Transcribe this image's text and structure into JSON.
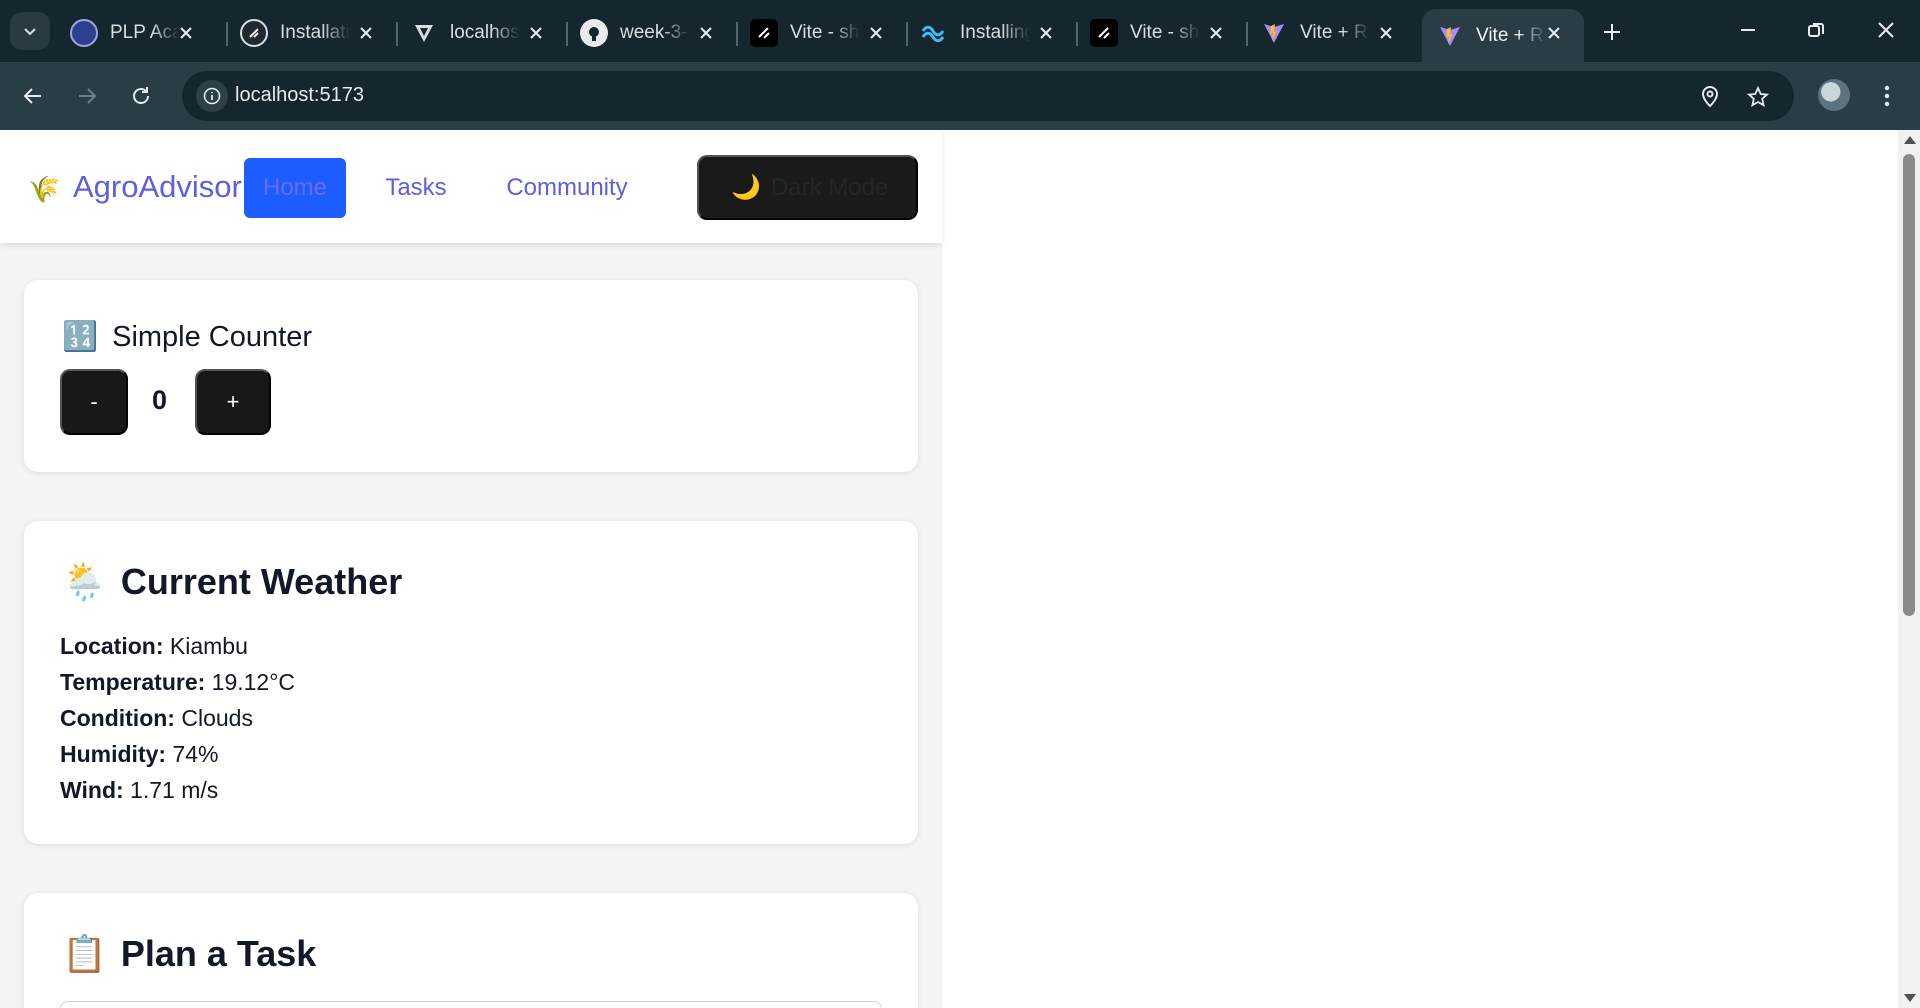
{
  "browser": {
    "tabs": [
      {
        "title": "PLP Academy",
        "favicon": "plp-icon"
      },
      {
        "title": "Installation",
        "favicon": "shadcn-icon"
      },
      {
        "title": "localhost",
        "favicon": "vercel-icon"
      },
      {
        "title": "week-3-",
        "favicon": "github-icon"
      },
      {
        "title": "Vite - shadcn",
        "favicon": "shadcn-icon"
      },
      {
        "title": "Installing",
        "favicon": "tailwind-icon"
      },
      {
        "title": "Vite - shadcn",
        "favicon": "shadcn-icon"
      },
      {
        "title": "Vite + React",
        "favicon": "vite-icon"
      },
      {
        "title": "Vite + React",
        "favicon": "vite-icon",
        "active": true
      }
    ],
    "url": "localhost:5173"
  },
  "app": {
    "brand": {
      "icon": "🌾",
      "name": "AgroAdvisor"
    },
    "nav": {
      "home": "Home",
      "tasks": "Tasks",
      "community": "Community"
    },
    "theme_toggle": {
      "icon": "🌙",
      "label": "Dark Mode"
    },
    "counter": {
      "icon": "🔢",
      "title": "Simple Counter",
      "decrement": "-",
      "value": "0",
      "increment": "+"
    },
    "weather": {
      "icon": "🌦️",
      "title": "Current Weather",
      "rows": [
        {
          "label": "Location:",
          "value": "Kiambu"
        },
        {
          "label": "Temperature:",
          "value": "19.12°C"
        },
        {
          "label": "Condition:",
          "value": "Clouds"
        },
        {
          "label": "Humidity:",
          "value": "74%"
        },
        {
          "label": "Wind:",
          "value": "1.71 m/s"
        }
      ]
    },
    "task_planner": {
      "icon": "📋",
      "title": "Plan a Task"
    }
  },
  "colors": {
    "accent": "#5b5fe6",
    "active_nav_bg": "#1d5cff",
    "chrome_dark": "#16262e",
    "chrome_toolbar": "#2a3d46"
  }
}
